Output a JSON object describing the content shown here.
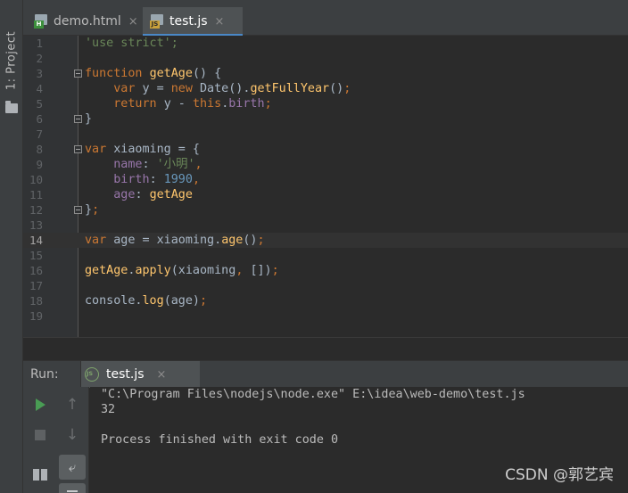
{
  "sidebar": {
    "project_tab_label": "1: Project",
    "project_icon": "folder-icon"
  },
  "tabs": [
    {
      "label": "demo.html",
      "icon": "html-file-icon",
      "badge": "H",
      "active": false
    },
    {
      "label": "test.js",
      "icon": "js-file-icon",
      "badge": "JS",
      "active": true
    }
  ],
  "tab_close_glyph": "×",
  "editor": {
    "current_line": 14,
    "line_numbers": [
      "1",
      "2",
      "3",
      "4",
      "5",
      "6",
      "7",
      "8",
      "9",
      "10",
      "11",
      "12",
      "13",
      "14",
      "15",
      "16",
      "17",
      "18",
      "19"
    ],
    "lines": [
      [
        {
          "t": "'use strict';",
          "c": "str"
        }
      ],
      [],
      [
        {
          "t": "function ",
          "c": "kw"
        },
        {
          "t": "getAge",
          "c": "fn"
        },
        {
          "t": "() {",
          "c": "plain"
        }
      ],
      [
        {
          "t": "    ",
          "c": "plain"
        },
        {
          "t": "var ",
          "c": "kw"
        },
        {
          "t": "y = ",
          "c": "plain"
        },
        {
          "t": "new ",
          "c": "kw"
        },
        {
          "t": "Date().",
          "c": "plain"
        },
        {
          "t": "getFullYear",
          "c": "fn"
        },
        {
          "t": "()",
          "c": "plain"
        },
        {
          "t": ";",
          "c": "kw"
        }
      ],
      [
        {
          "t": "    ",
          "c": "plain"
        },
        {
          "t": "return ",
          "c": "kw"
        },
        {
          "t": "y - ",
          "c": "plain"
        },
        {
          "t": "this",
          "c": "kw"
        },
        {
          "t": ".",
          "c": "plain"
        },
        {
          "t": "birth",
          "c": "prop"
        },
        {
          "t": ";",
          "c": "kw"
        }
      ],
      [
        {
          "t": "}",
          "c": "plain"
        }
      ],
      [],
      [
        {
          "t": "var ",
          "c": "kw"
        },
        {
          "t": "xiaoming = {",
          "c": "plain"
        }
      ],
      [
        {
          "t": "    ",
          "c": "plain"
        },
        {
          "t": "name",
          "c": "prop"
        },
        {
          "t": ": ",
          "c": "plain"
        },
        {
          "t": "'小明'",
          "c": "str"
        },
        {
          "t": ",",
          "c": "kw"
        }
      ],
      [
        {
          "t": "    ",
          "c": "plain"
        },
        {
          "t": "birth",
          "c": "prop"
        },
        {
          "t": ": ",
          "c": "plain"
        },
        {
          "t": "1990",
          "c": "num"
        },
        {
          "t": ",",
          "c": "kw"
        }
      ],
      [
        {
          "t": "    ",
          "c": "plain"
        },
        {
          "t": "age",
          "c": "prop"
        },
        {
          "t": ": ",
          "c": "plain"
        },
        {
          "t": "getAge",
          "c": "fn"
        }
      ],
      [
        {
          "t": "}",
          "c": "plain"
        },
        {
          "t": ";",
          "c": "kw"
        }
      ],
      [],
      [
        {
          "t": "var ",
          "c": "kw"
        },
        {
          "t": "age = xiaoming.",
          "c": "plain"
        },
        {
          "t": "age",
          "c": "fn"
        },
        {
          "t": "()",
          "c": "plain"
        },
        {
          "t": ";",
          "c": "kw"
        }
      ],
      [],
      [
        {
          "t": "getAge",
          "c": "fn"
        },
        {
          "t": ".",
          "c": "plain"
        },
        {
          "t": "apply",
          "c": "fn"
        },
        {
          "t": "(xiaoming",
          "c": "plain"
        },
        {
          "t": ", ",
          "c": "kw"
        },
        {
          "t": "[])",
          "c": "plain"
        },
        {
          "t": ";",
          "c": "kw"
        }
      ],
      [],
      [
        {
          "t": "console.",
          "c": "plain"
        },
        {
          "t": "log",
          "c": "fn"
        },
        {
          "t": "(age)",
          "c": "plain"
        },
        {
          "t": ";",
          "c": "kw"
        }
      ],
      []
    ],
    "fold_markers": [
      3,
      6,
      8,
      12
    ]
  },
  "run_panel": {
    "label": "Run:",
    "tab_label": "test.js",
    "tab_icon": "nodejs-icon",
    "toolbar_icons": [
      "play-icon",
      "arrow-up-icon",
      "stop-icon",
      "arrow-down-icon",
      "layout-icon",
      "soft-wrap-icon",
      "scroll-to-end-icon"
    ],
    "arrow_up_glyph": "↑",
    "arrow_down_glyph": "↓",
    "wrap_glyph": "⤶",
    "console_lines": [
      "\"C:\\Program Files\\nodejs\\node.exe\" E:\\idea\\web-demo\\test.js",
      "32",
      "",
      "Process finished with exit code 0"
    ]
  },
  "watermark": "CSDN @郭艺宾",
  "colors": {
    "keyword": "#cc7832",
    "function": "#ffc66d",
    "property": "#9876aa",
    "string": "#6a8759",
    "number": "#6897bb",
    "accent": "#4a88c7"
  }
}
